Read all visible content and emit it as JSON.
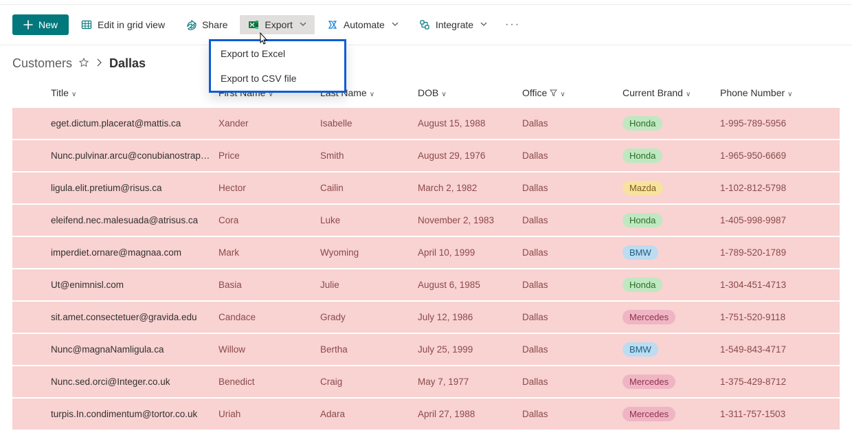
{
  "toolbar": {
    "new_label": "New",
    "edit_grid_label": "Edit in grid view",
    "share_label": "Share",
    "export_label": "Export",
    "automate_label": "Automate",
    "integrate_label": "Integrate"
  },
  "export_menu": {
    "excel": "Export to Excel",
    "csv": "Export to CSV file"
  },
  "breadcrumb": {
    "root": "Customers",
    "current": "Dallas"
  },
  "columns": {
    "title": "Title",
    "first_name": "First Name",
    "last_name": "Last Name",
    "dob": "DOB",
    "office": "Office",
    "brand": "Current Brand",
    "phone": "Phone Number"
  },
  "rows": [
    {
      "title": "eget.dictum.placerat@mattis.ca",
      "first": "Xander",
      "last": "Isabelle",
      "dob": "August 15, 1988",
      "office": "Dallas",
      "brand": "Honda",
      "phone": "1-995-789-5956"
    },
    {
      "title": "Nunc.pulvinar.arcu@conubianostraper.edu",
      "first": "Price",
      "last": "Smith",
      "dob": "August 29, 1976",
      "office": "Dallas",
      "brand": "Honda",
      "phone": "1-965-950-6669"
    },
    {
      "title": "ligula.elit.pretium@risus.ca",
      "first": "Hector",
      "last": "Cailin",
      "dob": "March 2, 1982",
      "office": "Dallas",
      "brand": "Mazda",
      "phone": "1-102-812-5798"
    },
    {
      "title": "eleifend.nec.malesuada@atrisus.ca",
      "first": "Cora",
      "last": "Luke",
      "dob": "November 2, 1983",
      "office": "Dallas",
      "brand": "Honda",
      "phone": "1-405-998-9987"
    },
    {
      "title": "imperdiet.ornare@magnaa.com",
      "first": "Mark",
      "last": "Wyoming",
      "dob": "April 10, 1999",
      "office": "Dallas",
      "brand": "BMW",
      "phone": "1-789-520-1789"
    },
    {
      "title": "Ut@enimnisl.com",
      "first": "Basia",
      "last": "Julie",
      "dob": "August 6, 1985",
      "office": "Dallas",
      "brand": "Honda",
      "phone": "1-304-451-4713"
    },
    {
      "title": "sit.amet.consectetuer@gravida.edu",
      "first": "Candace",
      "last": "Grady",
      "dob": "July 12, 1986",
      "office": "Dallas",
      "brand": "Mercedes",
      "phone": "1-751-520-9118"
    },
    {
      "title": "Nunc@magnaNamligula.ca",
      "first": "Willow",
      "last": "Bertha",
      "dob": "July 25, 1999",
      "office": "Dallas",
      "brand": "BMW",
      "phone": "1-549-843-4717"
    },
    {
      "title": "Nunc.sed.orci@Integer.co.uk",
      "first": "Benedict",
      "last": "Craig",
      "dob": "May 7, 1977",
      "office": "Dallas",
      "brand": "Mercedes",
      "phone": "1-375-429-8712"
    },
    {
      "title": "turpis.In.condimentum@tortor.co.uk",
      "first": "Uriah",
      "last": "Adara",
      "dob": "April 27, 1988",
      "office": "Dallas",
      "brand": "Mercedes",
      "phone": "1-311-757-1503"
    }
  ]
}
